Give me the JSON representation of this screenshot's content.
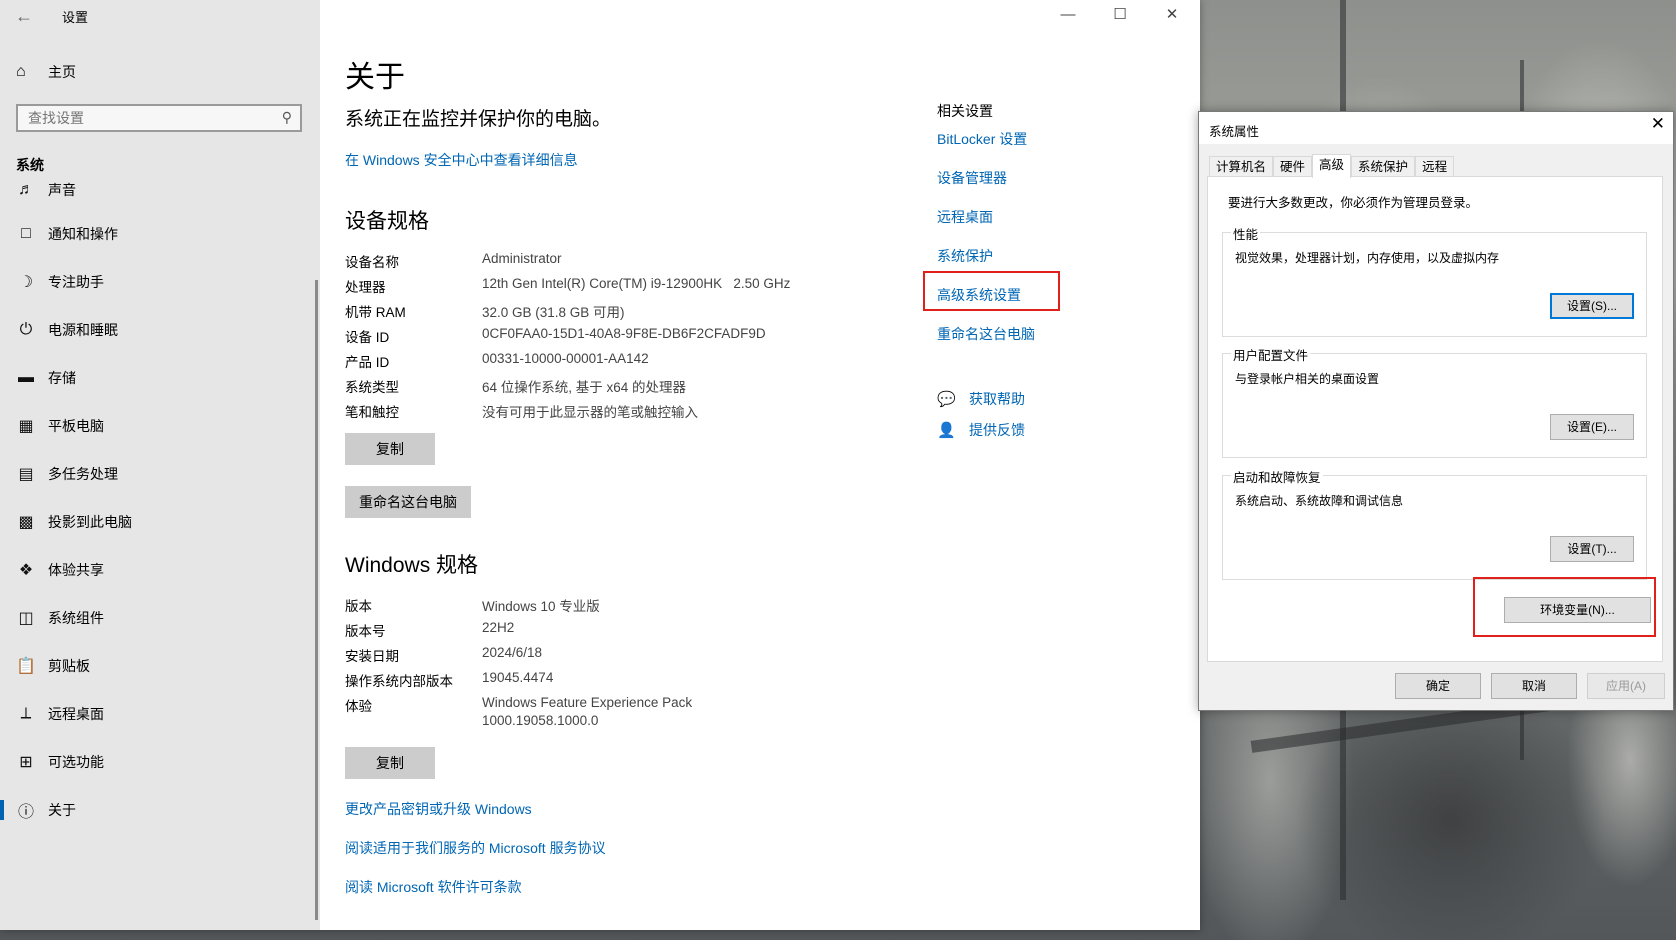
{
  "settings": {
    "app_title": "设置",
    "home_label": "主页",
    "search_placeholder": "查找设置",
    "section_label": "系统",
    "nav": [
      {
        "label": "声音",
        "icon": "speaker-icon"
      },
      {
        "label": "通知和操作",
        "icon": "notification-icon"
      },
      {
        "label": "专注助手",
        "icon": "moon-icon"
      },
      {
        "label": "电源和睡眠",
        "icon": "power-icon"
      },
      {
        "label": "存储",
        "icon": "storage-icon"
      },
      {
        "label": "平板电脑",
        "icon": "tablet-icon"
      },
      {
        "label": "多任务处理",
        "icon": "multitask-icon"
      },
      {
        "label": "投影到此电脑",
        "icon": "project-icon"
      },
      {
        "label": "体验共享",
        "icon": "share-icon"
      },
      {
        "label": "系统组件",
        "icon": "components-icon"
      },
      {
        "label": "剪贴板",
        "icon": "clipboard-icon"
      },
      {
        "label": "远程桌面",
        "icon": "remote-desktop-icon"
      },
      {
        "label": "可选功能",
        "icon": "optional-features-icon"
      },
      {
        "label": "关于",
        "icon": "info-icon",
        "active": true
      }
    ]
  },
  "about": {
    "title": "关于",
    "subtitle": "系统正在监控并保护你的电脑。",
    "security_link": "在 Windows 安全中心中查看详细信息",
    "device_specs_title": "设备规格",
    "device_specs": [
      {
        "key": "设备名称",
        "value": "Administrator"
      },
      {
        "key": "处理器",
        "value": "12th Gen Intel(R) Core(TM) i9-12900HK   2.50 GHz"
      },
      {
        "key": "机带 RAM",
        "value": "32.0 GB (31.8 GB 可用)"
      },
      {
        "key": "设备 ID",
        "value": "0CF0FAA0-15D1-40A8-9F8E-DB6F2CFADF9D"
      },
      {
        "key": "产品 ID",
        "value": "00331-10000-00001-AA142"
      },
      {
        "key": "系统类型",
        "value": "64 位操作系统, 基于 x64 的处理器"
      },
      {
        "key": "笔和触控",
        "value": "没有可用于此显示器的笔或触控输入"
      }
    ],
    "copy_label": "复制",
    "rename_label": "重命名这台电脑",
    "windows_specs_title": "Windows 规格",
    "windows_specs": [
      {
        "key": "版本",
        "value": "Windows 10 专业版"
      },
      {
        "key": "版本号",
        "value": "22H2"
      },
      {
        "key": "安装日期",
        "value": "2024/6/18"
      },
      {
        "key": "操作系统内部版本",
        "value": "19045.4474"
      },
      {
        "key": "体验",
        "value": "Windows Feature Experience Pack",
        "value2": "1000.19058.1000.0"
      }
    ],
    "copy2_label": "复制",
    "links": [
      "更改产品密钥或升级 Windows",
      "阅读适用于我们服务的 Microsoft 服务协议",
      "阅读 Microsoft 软件许可条款"
    ]
  },
  "related": {
    "title": "相关设置",
    "links": [
      "BitLocker 设置",
      "设备管理器",
      "远程桌面",
      "系统保护",
      "高级系统设置",
      "重命名这台电脑"
    ],
    "help": "获取帮助",
    "feedback": "提供反馈"
  },
  "dialog": {
    "title": "系统属性",
    "tabs": [
      "计算机名",
      "硬件",
      "高级",
      "系统保护",
      "远程"
    ],
    "selected_tab": "高级",
    "admin_note": "要进行大多数更改，你必须作为管理员登录。",
    "groups": [
      {
        "title": "性能",
        "desc": "视觉效果，处理器计划，内存使用，以及虚拟内存",
        "button": "设置(S)..."
      },
      {
        "title": "用户配置文件",
        "desc": "与登录帐户相关的桌面设置",
        "button": "设置(E)..."
      },
      {
        "title": "启动和故障恢复",
        "desc": "系统启动、系统故障和调试信息",
        "button": "设置(T)..."
      }
    ],
    "env_button": "环境变量(N)...",
    "ok": "确定",
    "cancel": "取消",
    "apply": "应用(A)"
  }
}
